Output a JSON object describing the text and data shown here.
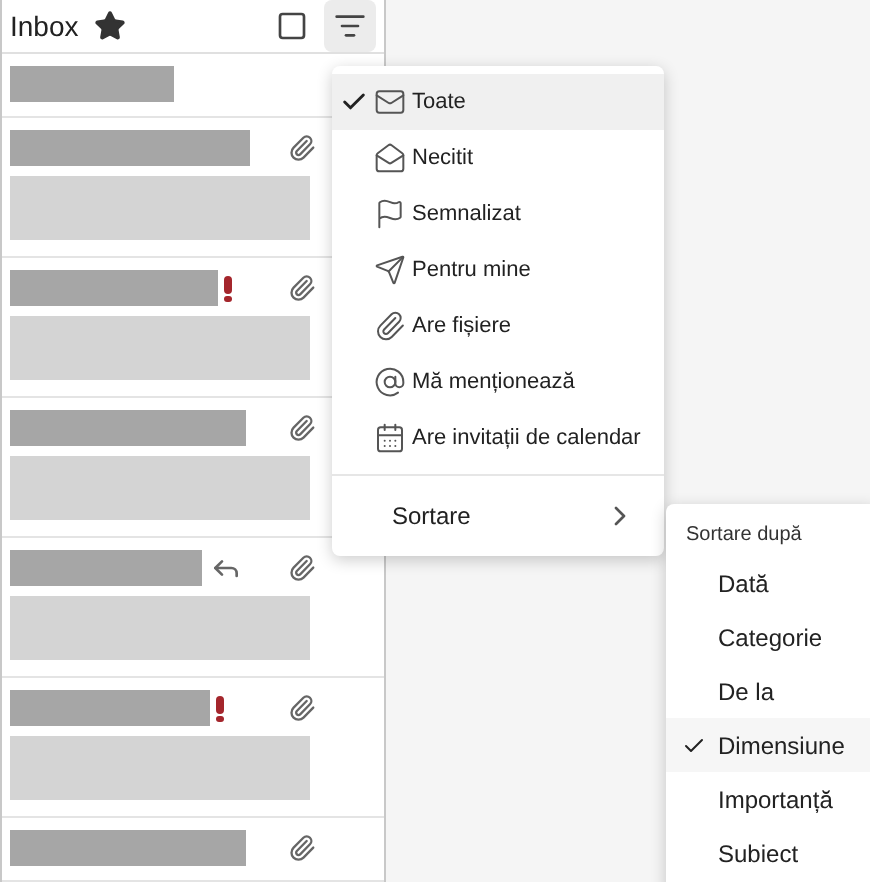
{
  "header": {
    "title": "Inbox"
  },
  "messages": [
    {
      "important": false,
      "replied": false,
      "attachment": false,
      "preview": false
    },
    {
      "important": false,
      "replied": false,
      "attachment": true,
      "preview": true
    },
    {
      "important": true,
      "replied": false,
      "attachment": true,
      "preview": true
    },
    {
      "important": false,
      "replied": false,
      "attachment": true,
      "preview": true
    },
    {
      "important": false,
      "replied": true,
      "attachment": true,
      "preview": true
    },
    {
      "important": true,
      "replied": false,
      "attachment": true,
      "preview": true
    },
    {
      "important": false,
      "replied": false,
      "attachment": true,
      "preview": false
    }
  ],
  "filter_menu": {
    "items": [
      {
        "kind": "all",
        "label": "Toate",
        "selected": true
      },
      {
        "kind": "unread",
        "label": "Necitit",
        "selected": false
      },
      {
        "kind": "flagged",
        "label": "Semnalizat",
        "selected": false
      },
      {
        "kind": "tome",
        "label": "Pentru mine",
        "selected": false
      },
      {
        "kind": "files",
        "label": "Are fișiere",
        "selected": false
      },
      {
        "kind": "mentions",
        "label": "Mă menționează",
        "selected": false
      },
      {
        "kind": "invites",
        "label": "Are invitații de calendar",
        "selected": false
      }
    ],
    "sort_label": "Sortare"
  },
  "sort_menu": {
    "heading": "Sortare după",
    "items": [
      {
        "label": "Dată",
        "selected": false
      },
      {
        "label": "Categorie",
        "selected": false
      },
      {
        "label": "De la",
        "selected": false
      },
      {
        "label": "Dimensiune",
        "selected": true
      },
      {
        "label": "Importanță",
        "selected": false
      },
      {
        "label": "Subiect",
        "selected": false
      }
    ]
  }
}
